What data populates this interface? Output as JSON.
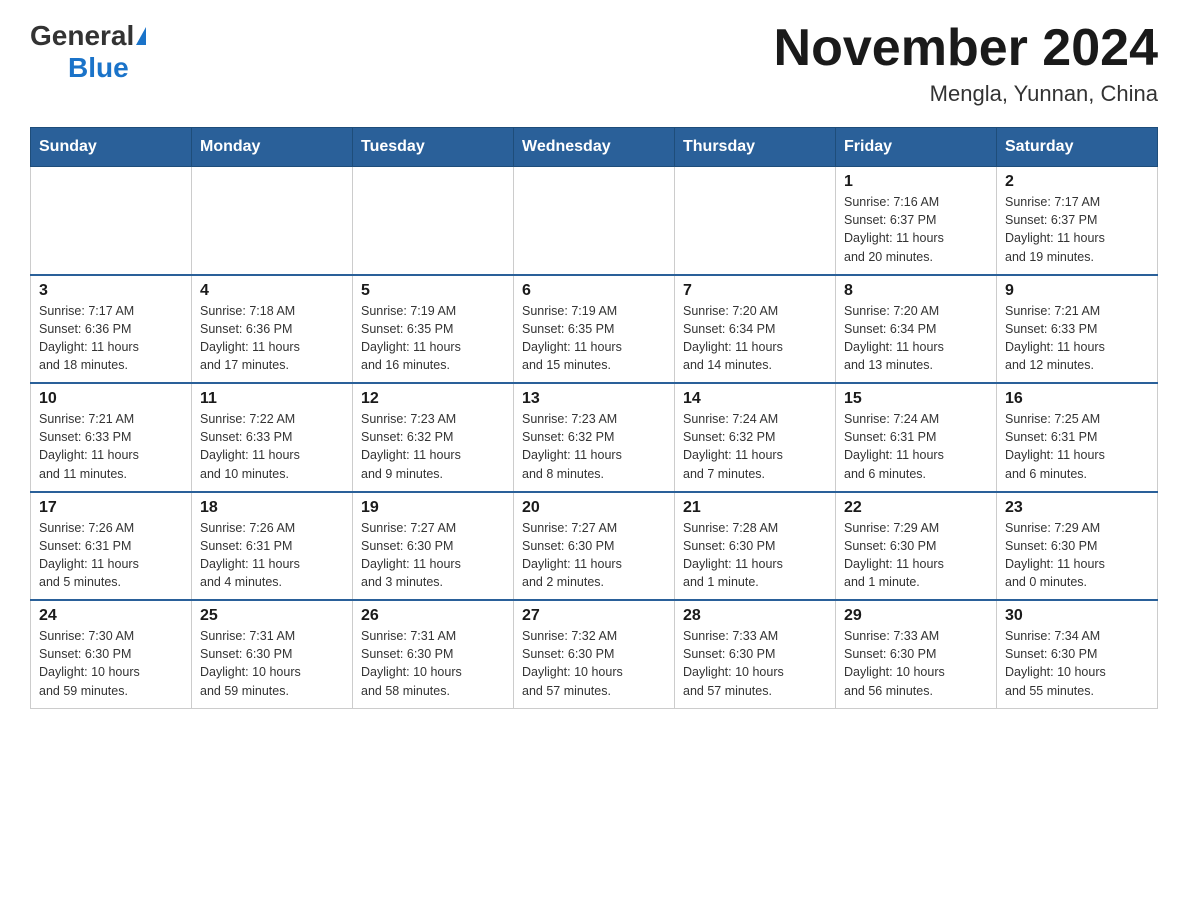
{
  "header": {
    "logo_general": "General",
    "logo_blue": "Blue",
    "month_title": "November 2024",
    "location": "Mengla, Yunnan, China"
  },
  "weekdays": [
    "Sunday",
    "Monday",
    "Tuesday",
    "Wednesday",
    "Thursday",
    "Friday",
    "Saturday"
  ],
  "weeks": [
    [
      {
        "day": "",
        "info": ""
      },
      {
        "day": "",
        "info": ""
      },
      {
        "day": "",
        "info": ""
      },
      {
        "day": "",
        "info": ""
      },
      {
        "day": "",
        "info": ""
      },
      {
        "day": "1",
        "info": "Sunrise: 7:16 AM\nSunset: 6:37 PM\nDaylight: 11 hours\nand 20 minutes."
      },
      {
        "day": "2",
        "info": "Sunrise: 7:17 AM\nSunset: 6:37 PM\nDaylight: 11 hours\nand 19 minutes."
      }
    ],
    [
      {
        "day": "3",
        "info": "Sunrise: 7:17 AM\nSunset: 6:36 PM\nDaylight: 11 hours\nand 18 minutes."
      },
      {
        "day": "4",
        "info": "Sunrise: 7:18 AM\nSunset: 6:36 PM\nDaylight: 11 hours\nand 17 minutes."
      },
      {
        "day": "5",
        "info": "Sunrise: 7:19 AM\nSunset: 6:35 PM\nDaylight: 11 hours\nand 16 minutes."
      },
      {
        "day": "6",
        "info": "Sunrise: 7:19 AM\nSunset: 6:35 PM\nDaylight: 11 hours\nand 15 minutes."
      },
      {
        "day": "7",
        "info": "Sunrise: 7:20 AM\nSunset: 6:34 PM\nDaylight: 11 hours\nand 14 minutes."
      },
      {
        "day": "8",
        "info": "Sunrise: 7:20 AM\nSunset: 6:34 PM\nDaylight: 11 hours\nand 13 minutes."
      },
      {
        "day": "9",
        "info": "Sunrise: 7:21 AM\nSunset: 6:33 PM\nDaylight: 11 hours\nand 12 minutes."
      }
    ],
    [
      {
        "day": "10",
        "info": "Sunrise: 7:21 AM\nSunset: 6:33 PM\nDaylight: 11 hours\nand 11 minutes."
      },
      {
        "day": "11",
        "info": "Sunrise: 7:22 AM\nSunset: 6:33 PM\nDaylight: 11 hours\nand 10 minutes."
      },
      {
        "day": "12",
        "info": "Sunrise: 7:23 AM\nSunset: 6:32 PM\nDaylight: 11 hours\nand 9 minutes."
      },
      {
        "day": "13",
        "info": "Sunrise: 7:23 AM\nSunset: 6:32 PM\nDaylight: 11 hours\nand 8 minutes."
      },
      {
        "day": "14",
        "info": "Sunrise: 7:24 AM\nSunset: 6:32 PM\nDaylight: 11 hours\nand 7 minutes."
      },
      {
        "day": "15",
        "info": "Sunrise: 7:24 AM\nSunset: 6:31 PM\nDaylight: 11 hours\nand 6 minutes."
      },
      {
        "day": "16",
        "info": "Sunrise: 7:25 AM\nSunset: 6:31 PM\nDaylight: 11 hours\nand 6 minutes."
      }
    ],
    [
      {
        "day": "17",
        "info": "Sunrise: 7:26 AM\nSunset: 6:31 PM\nDaylight: 11 hours\nand 5 minutes."
      },
      {
        "day": "18",
        "info": "Sunrise: 7:26 AM\nSunset: 6:31 PM\nDaylight: 11 hours\nand 4 minutes."
      },
      {
        "day": "19",
        "info": "Sunrise: 7:27 AM\nSunset: 6:30 PM\nDaylight: 11 hours\nand 3 minutes."
      },
      {
        "day": "20",
        "info": "Sunrise: 7:27 AM\nSunset: 6:30 PM\nDaylight: 11 hours\nand 2 minutes."
      },
      {
        "day": "21",
        "info": "Sunrise: 7:28 AM\nSunset: 6:30 PM\nDaylight: 11 hours\nand 1 minute."
      },
      {
        "day": "22",
        "info": "Sunrise: 7:29 AM\nSunset: 6:30 PM\nDaylight: 11 hours\nand 1 minute."
      },
      {
        "day": "23",
        "info": "Sunrise: 7:29 AM\nSunset: 6:30 PM\nDaylight: 11 hours\nand 0 minutes."
      }
    ],
    [
      {
        "day": "24",
        "info": "Sunrise: 7:30 AM\nSunset: 6:30 PM\nDaylight: 10 hours\nand 59 minutes."
      },
      {
        "day": "25",
        "info": "Sunrise: 7:31 AM\nSunset: 6:30 PM\nDaylight: 10 hours\nand 59 minutes."
      },
      {
        "day": "26",
        "info": "Sunrise: 7:31 AM\nSunset: 6:30 PM\nDaylight: 10 hours\nand 58 minutes."
      },
      {
        "day": "27",
        "info": "Sunrise: 7:32 AM\nSunset: 6:30 PM\nDaylight: 10 hours\nand 57 minutes."
      },
      {
        "day": "28",
        "info": "Sunrise: 7:33 AM\nSunset: 6:30 PM\nDaylight: 10 hours\nand 57 minutes."
      },
      {
        "day": "29",
        "info": "Sunrise: 7:33 AM\nSunset: 6:30 PM\nDaylight: 10 hours\nand 56 minutes."
      },
      {
        "day": "30",
        "info": "Sunrise: 7:34 AM\nSunset: 6:30 PM\nDaylight: 10 hours\nand 55 minutes."
      }
    ]
  ]
}
